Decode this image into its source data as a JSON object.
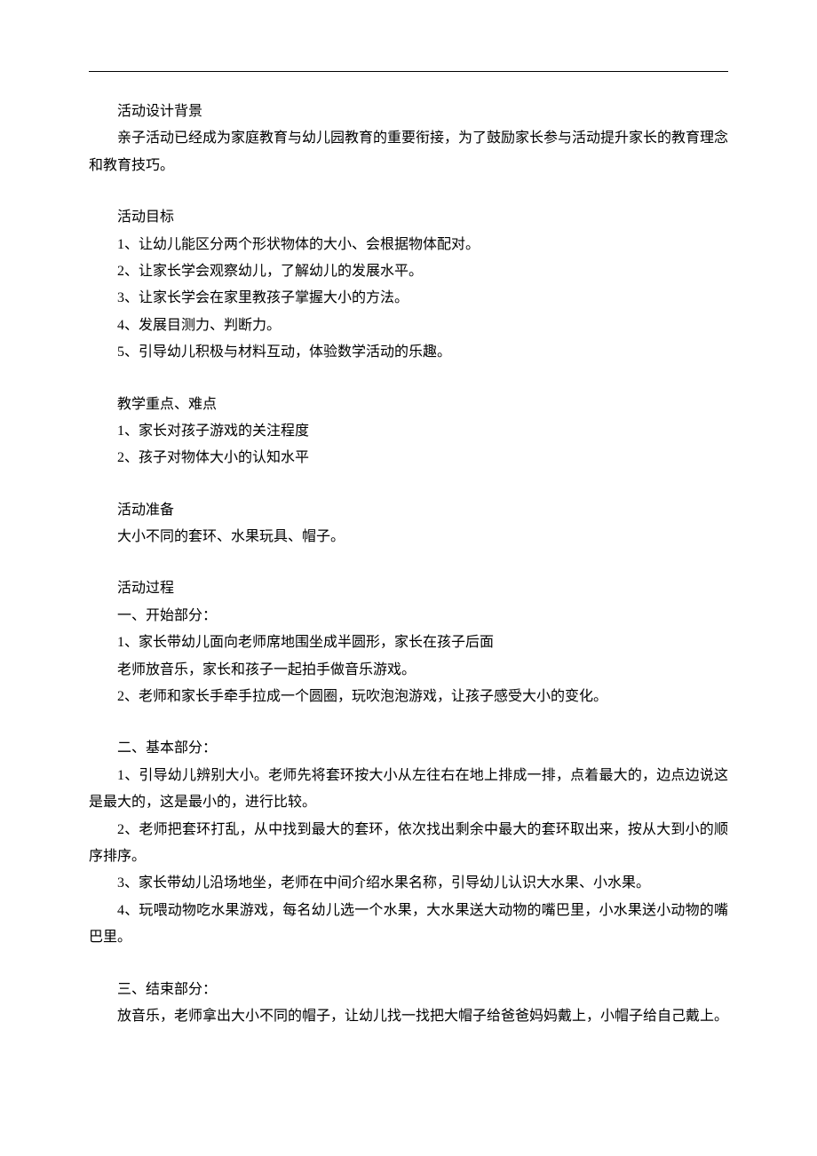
{
  "sections": {
    "background": {
      "title": "活动设计背景",
      "content": "亲子活动已经成为家庭教育与幼儿园教育的重要衔接，为了鼓励家长参与活动提升家长的教育理念和教育技巧。"
    },
    "goals": {
      "title": "活动目标",
      "items": [
        "1、让幼儿能区分两个形状物体的大小、会根据物体配对。",
        "2、让家长学会观察幼儿，了解幼儿的发展水平。",
        "3、让家长学会在家里教孩子掌握大小的方法。",
        "4、发展目测力、判断力。",
        "5、引导幼儿积极与材料互动，体验数学活动的乐趣。"
      ]
    },
    "keypoints": {
      "title": "教学重点、难点",
      "items": [
        "1、家长对孩子游戏的关注程度",
        "2、孩子对物体大小的认知水平"
      ]
    },
    "preparation": {
      "title": "活动准备",
      "content": "大小不同的套环、水果玩具、帽子。"
    },
    "process": {
      "title": "活动过程",
      "part1": {
        "title": "一、开始部分：",
        "lines": [
          "1、家长带幼儿面向老师席地围坐成半圆形，家长在孩子后面",
          "老师放音乐，家长和孩子一起拍手做音乐游戏。",
          "2、老师和家长手牵手拉成一个圆圈，玩吹泡泡游戏，让孩子感受大小的变化。"
        ]
      },
      "part2": {
        "title": "二、基本部分：",
        "lines": [
          "1、引导幼儿辨别大小。老师先将套环按大小从左往右在地上排成一排，点着最大的，边点边说这是最大的，这是最小的，进行比较。",
          "2、老师把套环打乱，从中找到最大的套环，依次找出剩余中最大的套环取出来，按从大到小的顺序排序。",
          "3、家长带幼儿沿场地坐，老师在中间介绍水果名称，引导幼儿认识大水果、小水果。",
          "4、玩喂动物吃水果游戏，每名幼儿选一个水果，大水果送大动物的嘴巴里，小水果送小动物的嘴巴里。"
        ]
      },
      "part3": {
        "title": "三、结束部分：",
        "content": "放音乐，老师拿出大小不同的帽子，让幼儿找一找把大帽子给爸爸妈妈戴上，小帽子给自己戴上。"
      }
    }
  }
}
